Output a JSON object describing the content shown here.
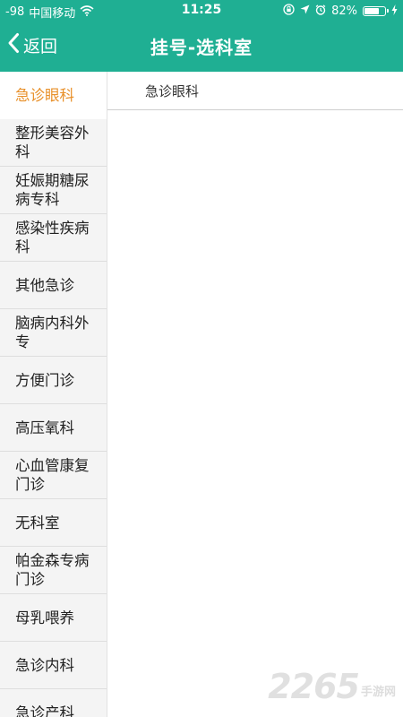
{
  "status_bar": {
    "signal": "-98",
    "carrier": "中国移动",
    "time": "11:25",
    "battery_percent_text": "82%",
    "battery_level": 0.82
  },
  "nav": {
    "back_label": "返回",
    "title": "挂号-选科室"
  },
  "sidebar": {
    "items": [
      {
        "label": "急诊眼科"
      },
      {
        "label": "整形美容外科"
      },
      {
        "label": "妊娠期糖尿病专科"
      },
      {
        "label": "感染性疾病科"
      },
      {
        "label": "其他急诊"
      },
      {
        "label": "脑病内科外专"
      },
      {
        "label": "方便门诊"
      },
      {
        "label": "高压氧科"
      },
      {
        "label": "心血管康复门诊"
      },
      {
        "label": "无科室"
      },
      {
        "label": "帕金森专病门诊"
      },
      {
        "label": "母乳喂养"
      },
      {
        "label": "急诊内科"
      },
      {
        "label": "急诊产科"
      }
    ]
  },
  "main": {
    "departments": [
      {
        "label": "急诊眼科"
      }
    ]
  },
  "watermark": {
    "number": "2265",
    "text": "手游网"
  },
  "colors": {
    "header": "#1faf93",
    "active_item": "#e8902a"
  }
}
